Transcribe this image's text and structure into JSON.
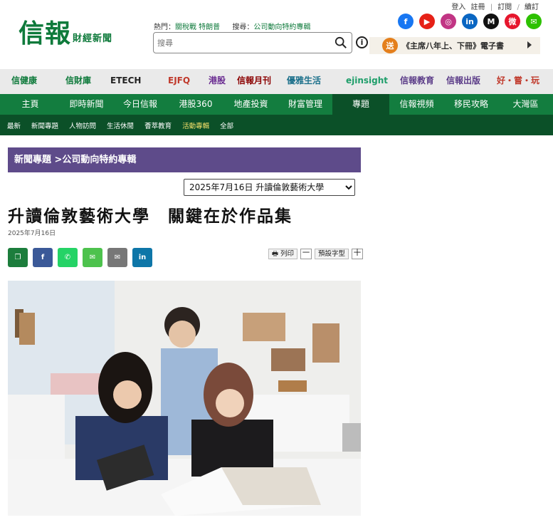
{
  "header": {
    "top_links": [
      "登入",
      "註冊",
      "訂閱",
      "續訂"
    ],
    "logo_main": "信報",
    "logo_sub": "財經新聞",
    "hot_label": "熱門：",
    "hot_value": "關稅戰 特朗普",
    "search_label": "搜尋：",
    "search_value": "公司動向特約專輯",
    "search_placeholder": "搜尋",
    "info_icon": "i",
    "promo_badge": "送",
    "promo_text": "《主席八年上、下冊》電子書",
    "socials": [
      {
        "name": "facebook",
        "glyph": "f",
        "color": "#1877f2"
      },
      {
        "name": "youtube",
        "glyph": "▶",
        "color": "#e62117"
      },
      {
        "name": "instagram",
        "glyph": "◎",
        "color": "#c13584"
      },
      {
        "name": "linkedin",
        "glyph": "in",
        "color": "#0a66c2"
      },
      {
        "name": "medium",
        "glyph": "M",
        "color": "#111111"
      },
      {
        "name": "weibo",
        "glyph": "微",
        "color": "#e6162d"
      },
      {
        "name": "wechat",
        "glyph": "✉",
        "color": "#2dc100"
      }
    ]
  },
  "brands": [
    {
      "label": "信健康",
      "color": "#0e7a3b"
    },
    {
      "label": "信財庫",
      "color": "#0e7a3b"
    },
    {
      "label": "ETECH",
      "color": "#222222"
    },
    {
      "label": "EJFQ",
      "color": "#c0392b"
    },
    {
      "label": "港股",
      "color": "#6a2c91"
    },
    {
      "label": "信報月刊",
      "color": "#8b0000"
    },
    {
      "label": "優雅生活",
      "color": "#1a6f8a"
    },
    {
      "label": "ejinsight",
      "color": "#1e9e6a"
    },
    {
      "label": "信報教育",
      "color": "#5b3c88"
    },
    {
      "label": "信報出版",
      "color": "#5b3c88"
    },
    {
      "label": "好・嘗・玩",
      "color": "#c0392b"
    }
  ],
  "nav": {
    "items": [
      "主頁",
      "即時新聞",
      "今日信報",
      "港股360",
      "地產投資",
      "財富管理",
      "專題",
      "信報視頻",
      "移民攻略",
      "大灣區"
    ],
    "active_index": 6
  },
  "sub_nav": {
    "items": [
      "最新",
      "新聞專題",
      "人物訪問",
      "生活休閒",
      "薈萃教育",
      "活動專輯",
      "全部"
    ],
    "active_index": 5
  },
  "article": {
    "section": "新聞專題 >公司動向特約專輯",
    "date_selector": "2025年7月16日 升讀倫敦藝術大學",
    "headline": "升讀倫敦藝術大學　關鍵在於作品集",
    "date": "2025年7月16日",
    "print_label": "列印",
    "font_minus": "－",
    "font_default": "預設字型",
    "font_plus": "＋",
    "share": [
      {
        "name": "copy-link",
        "glyph": "❐",
        "color": "#1c7d3c"
      },
      {
        "name": "facebook",
        "glyph": "f",
        "color": "#3b5998"
      },
      {
        "name": "whatsapp",
        "glyph": "✆",
        "color": "#25d366"
      },
      {
        "name": "wechat",
        "glyph": "✉",
        "color": "#4dc24d"
      },
      {
        "name": "email",
        "glyph": "✉",
        "color": "#777777"
      },
      {
        "name": "linkedin",
        "glyph": "in",
        "color": "#0e76a8"
      }
    ]
  }
}
